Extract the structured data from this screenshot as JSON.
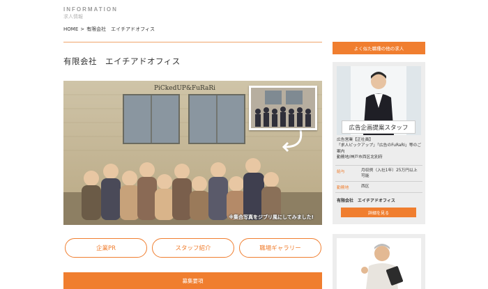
{
  "header": {
    "section_label": "INFORMATION",
    "section_sub": "求人情報"
  },
  "breadcrumb": {
    "home": "HOME",
    "separator": ">",
    "current": "有限会社　エイチアドオフィス"
  },
  "company": {
    "title": "有限会社　エイチアドオフィス"
  },
  "hero": {
    "sign_text": "PiCkedUP&FuRaRi",
    "caption": "※集合写真をジブリ風にしてみました!"
  },
  "tabs": [
    {
      "label": "企業PR"
    },
    {
      "label": "スタッフ紹介"
    },
    {
      "label": "職場ギャラリー"
    }
  ],
  "bottom_bar": {
    "label": "募集要項"
  },
  "sidebar": {
    "heading": "よく似た職種の他の求人",
    "card": {
      "job_title": "広告企画提案スタッフ",
      "desc_lines": [
        "広告営業【正社員】",
        "「求人ピックアップ」「広告のFuRaRi」等のご案内",
        "勤務地/神戸市西区北別府"
      ],
      "specs": [
        {
          "key": "給与",
          "value": "月収例（入社1年）25万円以上可能"
        },
        {
          "key": "勤務地",
          "value": "西区"
        }
      ],
      "company": "有限会社　エイチアドオフィス",
      "detail_button": "詳細を見る"
    }
  },
  "colors": {
    "accent": "#f07e2f",
    "rule": "#f0a36a",
    "card_bg": "#ededed"
  }
}
